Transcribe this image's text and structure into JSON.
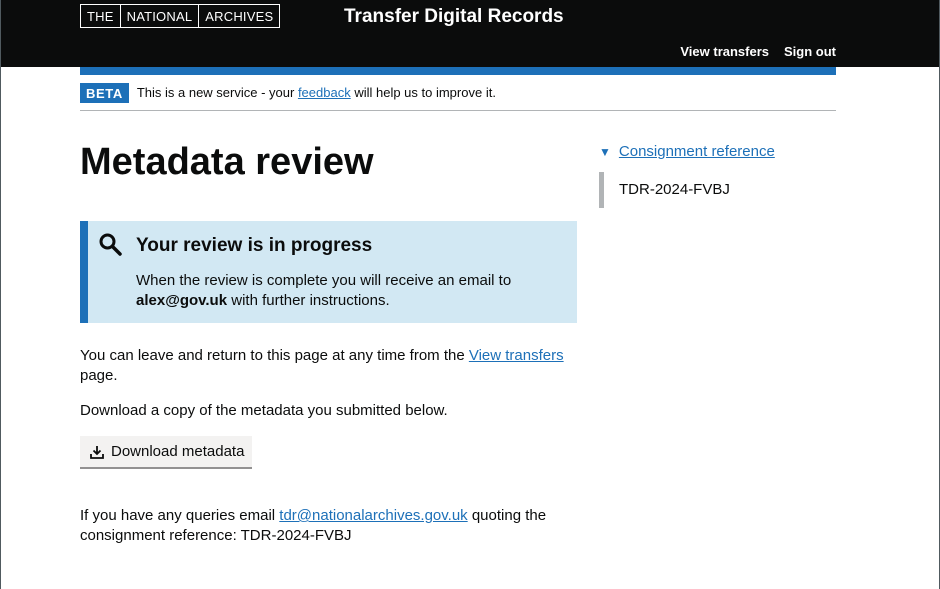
{
  "header": {
    "logo": [
      "THE",
      "NATIONAL",
      "ARCHIVES"
    ],
    "service_name": "Transfer Digital Records",
    "nav": {
      "view_transfers": "View transfers",
      "sign_out": "Sign out"
    }
  },
  "phase_banner": {
    "tag": "BETA",
    "text_before": "This is a new service - your ",
    "link": "feedback",
    "text_after": " will help us to improve it."
  },
  "main": {
    "title": "Metadata review",
    "notice": {
      "icon": "search-icon",
      "heading": "Your review is in progress",
      "body_before": "When the review is complete you will receive an email to ",
      "email": "alex@gov.uk",
      "body_after": " with further instructions."
    },
    "leave": {
      "before": "You can leave and return to this page at any time from the ",
      "link": "View transfers",
      "after": " page."
    },
    "download_intro": "Download a copy of the metadata you submitted below.",
    "download_button": {
      "icon": "download-icon",
      "label": "Download metadata"
    },
    "queries": {
      "before": "If you have any queries email ",
      "email_link": "tdr@nationalarchives.gov.uk",
      "after": " quoting the consignment reference: TDR-2024-FVBJ"
    }
  },
  "sidebar": {
    "summary_arrow": "▼",
    "summary_label": "Consignment reference",
    "reference": "TDR-2024-FVBJ"
  },
  "colors": {
    "header_bg": "#0b0c0c",
    "brand_blue": "#1d70b8",
    "notice_bg": "#d2e8f3",
    "button_bg": "#f3f2f1"
  }
}
